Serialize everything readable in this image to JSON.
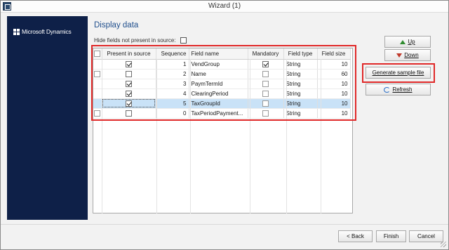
{
  "window": {
    "title": "Wizard (1)"
  },
  "sidebar": {
    "brand": "Microsoft Dynamics"
  },
  "page": {
    "title": "Display data",
    "hide_fields_label": "Hide fields not present in source:",
    "hide_fields_checked": false
  },
  "grid": {
    "columns": [
      "Present in source",
      "Sequence",
      "Field name",
      "Mandatory",
      "Field type",
      "Field size"
    ],
    "rows": [
      {
        "present": true,
        "sequence": "1",
        "field_name": "VendGroup",
        "mandatory": true,
        "field_type": "String",
        "field_size": "10",
        "selected": false
      },
      {
        "present": false,
        "sequence": "2",
        "field_name": "Name",
        "mandatory": false,
        "field_type": "String",
        "field_size": "60",
        "selected": false
      },
      {
        "present": true,
        "sequence": "3",
        "field_name": "PaymTermId",
        "mandatory": false,
        "field_type": "String",
        "field_size": "10",
        "selected": false
      },
      {
        "present": true,
        "sequence": "4",
        "field_name": "ClearingPeriod",
        "mandatory": false,
        "field_type": "String",
        "field_size": "10",
        "selected": false
      },
      {
        "present": true,
        "sequence": "5",
        "field_name": "TaxGroupId",
        "mandatory": false,
        "field_type": "String",
        "field_size": "10",
        "selected": true
      },
      {
        "present": false,
        "sequence": "0",
        "field_name": "TaxPeriodPayment...",
        "mandatory": false,
        "field_type": "String",
        "field_size": "10",
        "selected": false
      }
    ]
  },
  "side_buttons": {
    "up": "Up",
    "down": "Down",
    "generate": "Generate sample file",
    "refresh": "Refresh"
  },
  "footer": {
    "back": "< Back",
    "finish": "Finish",
    "cancel": "Cancel"
  },
  "colors": {
    "sidebar": "#0e2048",
    "title": "#1f4e8c",
    "highlight": "#e02828",
    "selected_row": "#c9e2f7"
  }
}
